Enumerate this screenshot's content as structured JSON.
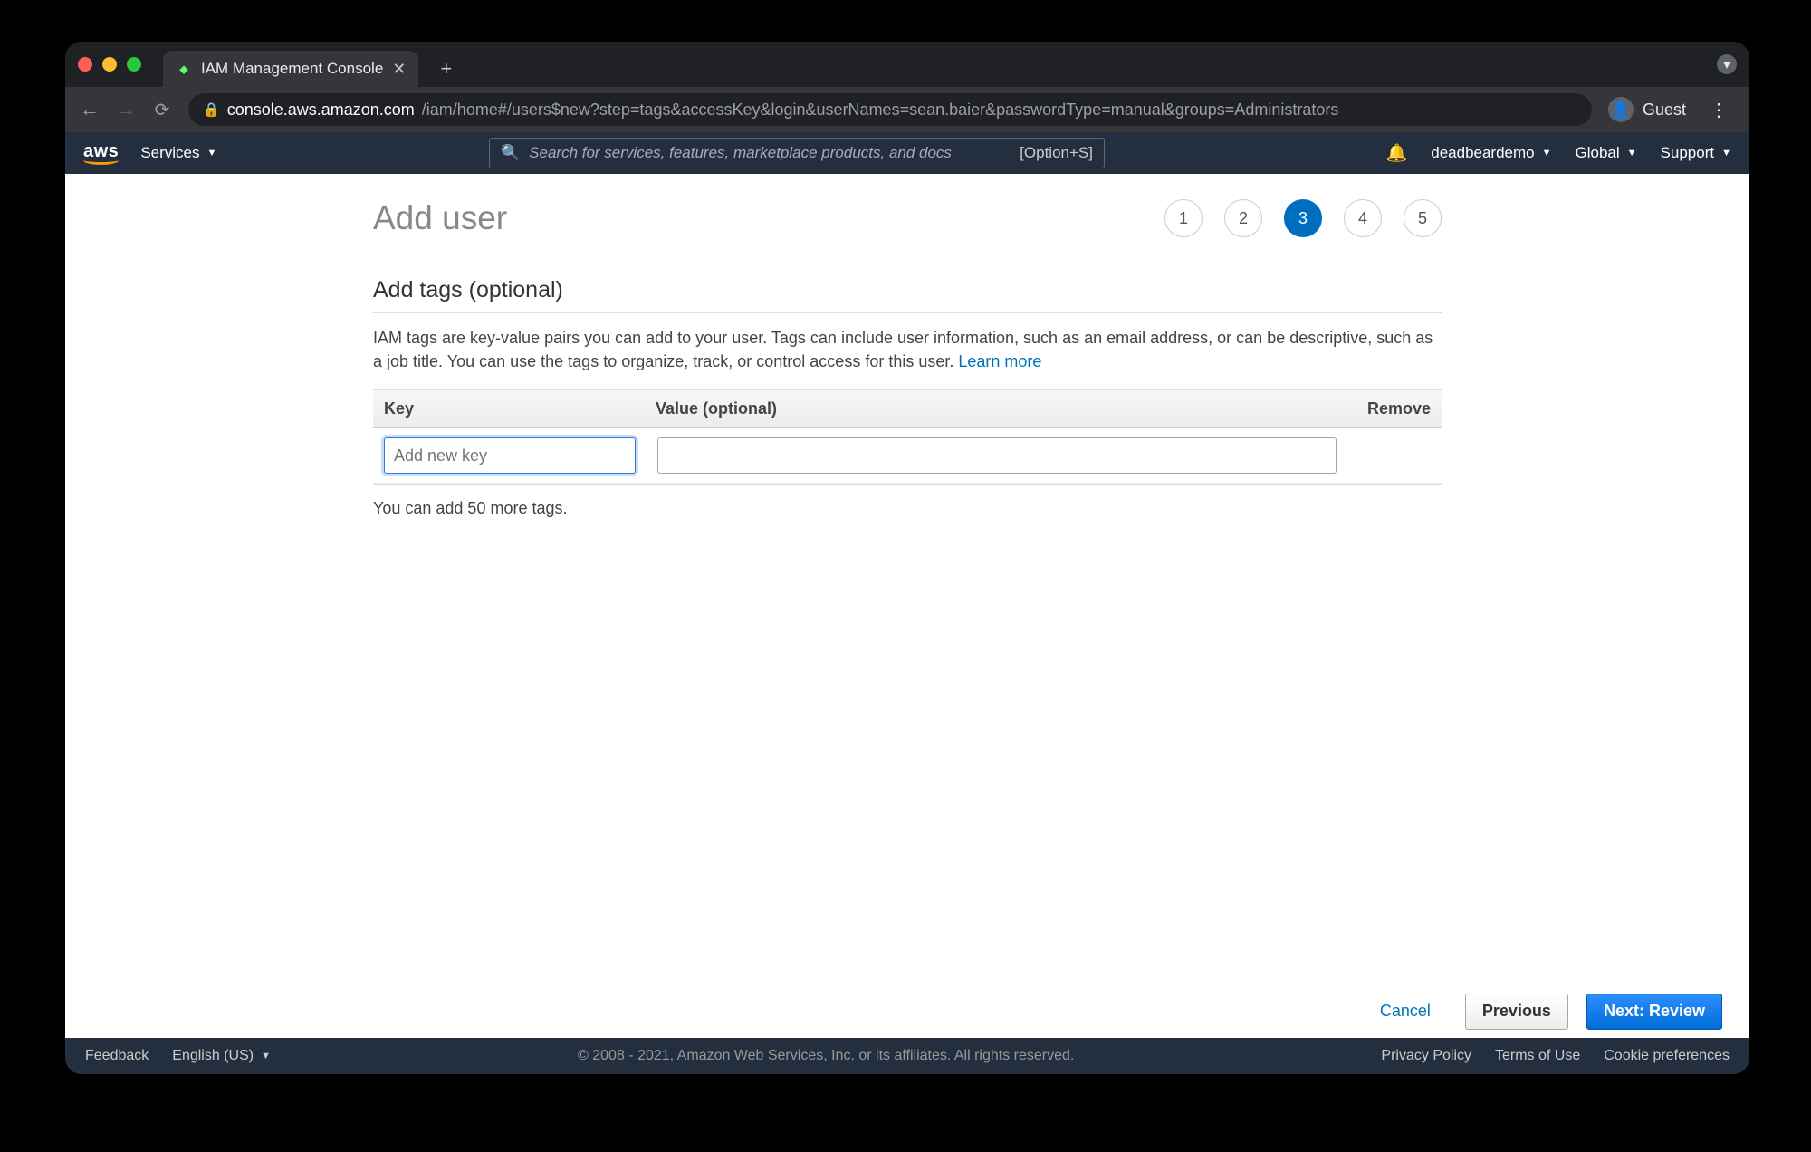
{
  "browser": {
    "tab_title": "IAM Management Console",
    "new_tab_label": "+",
    "guest_label": "Guest",
    "url_host": "console.aws.amazon.com",
    "url_path": "/iam/home#/users$new?step=tags&accessKey&login&userNames=sean.baier&passwordType=manual&groups=Administrators"
  },
  "aws_header": {
    "logo": "aws",
    "services": "Services",
    "search_placeholder": "Search for services, features, marketplace products, and docs",
    "search_shortcut": "[Option+S]",
    "account": "deadbeardemo",
    "region": "Global",
    "support": "Support"
  },
  "page": {
    "title": "Add user",
    "steps": [
      "1",
      "2",
      "3",
      "4",
      "5"
    ],
    "active_step_index": 2,
    "section_title": "Add tags (optional)",
    "description": "IAM tags are key-value pairs you can add to your user. Tags can include user information, such as an email address, or can be descriptive, such as a job title. You can use the tags to organize, track, or control access for this user. ",
    "learn_more": "Learn more",
    "col_key": "Key",
    "col_value": "Value (optional)",
    "col_remove": "Remove",
    "key_placeholder": "Add new key",
    "value_placeholder": "",
    "tags_remaining": "You can add 50 more tags."
  },
  "actions": {
    "cancel": "Cancel",
    "previous": "Previous",
    "next": "Next: Review"
  },
  "footer": {
    "feedback": "Feedback",
    "language": "English (US)",
    "copyright": "© 2008 - 2021, Amazon Web Services, Inc. or its affiliates. All rights reserved.",
    "privacy": "Privacy Policy",
    "terms": "Terms of Use",
    "cookies": "Cookie preferences"
  }
}
